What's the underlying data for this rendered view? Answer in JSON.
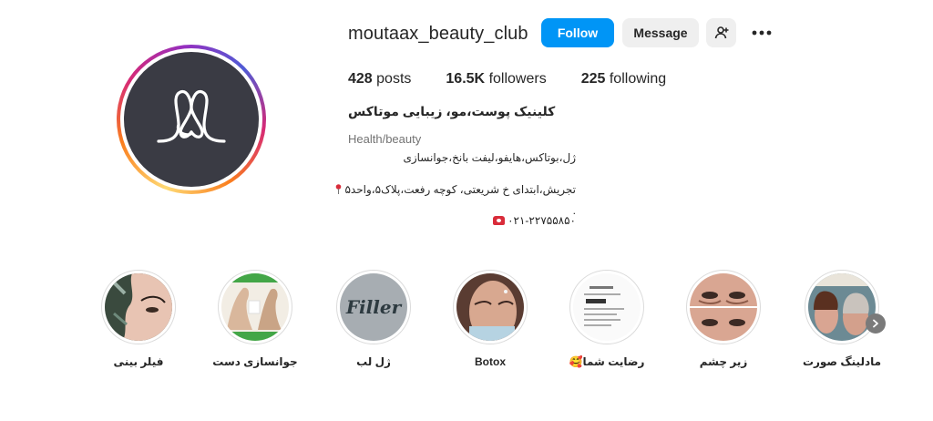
{
  "profile": {
    "username": "moutaax_beauty_club",
    "follow_label": "Follow",
    "message_label": "Message",
    "stats": {
      "posts_count": "428",
      "posts_label": "posts",
      "followers_count": "16.5K",
      "followers_label": "followers",
      "following_count": "225",
      "following_label": "following"
    },
    "bio": {
      "name": "کلینیک پوست،مو، زیبایی موتاکس",
      "category": "Health/beauty",
      "line1": "ژل،بوتاکس،هایفو،لیفت بانخ،جوانسازی",
      "line2": "تجریش،ابتدای خ شریعتی، کوچه رفعت،پلاک۵،واحد۵",
      "dot": ".",
      "line3": "۰۲۱-۲۲۷۵۵۸۵۰"
    }
  },
  "highlights": [
    {
      "label": "فیلر بینی"
    },
    {
      "label": "جوانسازی دست"
    },
    {
      "label": "ژل لب",
      "cover_text": "Filler"
    },
    {
      "label": "Botox"
    },
    {
      "label": "رضایت شما🥰"
    },
    {
      "label": "زیر چشم"
    },
    {
      "label": "مادلینگ صورت"
    }
  ],
  "colors": {
    "follow_button": "#0095f6",
    "secondary_button": "#efefef",
    "avatar_bg": "#3a3b44",
    "text_primary": "#262626",
    "text_secondary": "#737373"
  },
  "icons": {
    "add_user": "add-user-icon",
    "more": "more-horizontal-icon",
    "next": "chevron-right-icon",
    "pin": "round-pushpin-icon",
    "phone": "telephone-icon"
  }
}
